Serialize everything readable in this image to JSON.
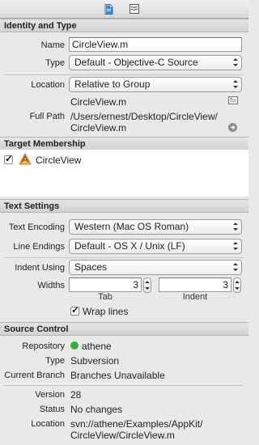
{
  "toolbar": {
    "file_icon": "file-inspector-icon",
    "help_icon": "quick-help-icon"
  },
  "identity": {
    "header": "Identity and Type",
    "name_label": "Name",
    "name_value": "CircleView.m",
    "type_label": "Type",
    "type_value": "Default - Objective-C Source",
    "location_label": "Location",
    "location_value": "Relative to Group",
    "relpath_value": "CircleView.m",
    "fullpath_label": "Full Path",
    "fullpath_line1": "/Users/ernest/Desktop/CircleView/",
    "fullpath_line2": "CircleView.m"
  },
  "membership": {
    "header": "Target Membership",
    "target_name": "CircleView",
    "checked": true
  },
  "text_settings": {
    "header": "Text Settings",
    "encoding_label": "Text Encoding",
    "encoding_value": "Western (Mac OS Roman)",
    "line_endings_label": "Line Endings",
    "line_endings_value": "Default - OS X / Unix (LF)",
    "indent_using_label": "Indent Using",
    "indent_using_value": "Spaces",
    "widths_label": "Widths",
    "tab_value": "3",
    "indent_value": "3",
    "tab_sublabel": "Tab",
    "indent_sublabel": "Indent",
    "wrap_label": "Wrap lines",
    "wrap_checked": true
  },
  "source_control": {
    "header": "Source Control",
    "repository_label": "Repository",
    "repository_value": "athene",
    "type_label": "Type",
    "type_value": "Subversion",
    "branch_label": "Current Branch",
    "branch_value": "Branches Unavailable",
    "version_label": "Version",
    "version_value": "28",
    "status_label": "Status",
    "status_value": "No changes",
    "location_label": "Location",
    "location_line1": "svn://athene/Examples/AppKit/",
    "location_line2": "CircleView/CircleView.m",
    "status_color": "#2fb52f"
  }
}
